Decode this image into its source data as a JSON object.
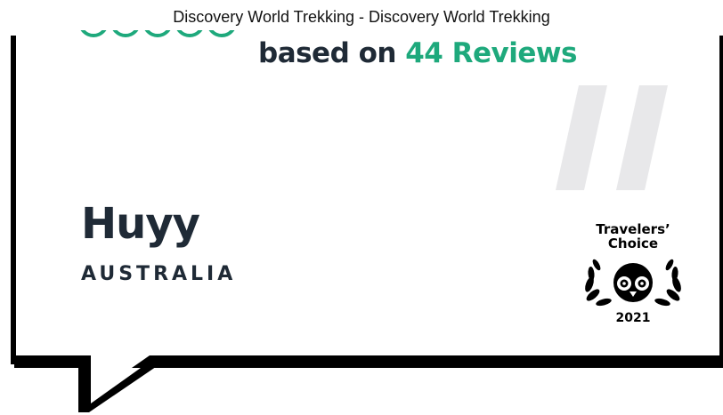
{
  "tooltip": {
    "text": "Discovery World Trekking - Discovery World Trekking"
  },
  "rating": {
    "prefix": "based on ",
    "count_text": "44 Reviews",
    "accent_color": "#1ea97c",
    "star_icon": "circle-rating-icon"
  },
  "review": {
    "name": "Huyy",
    "country": "AUSTRALIA"
  },
  "badge": {
    "title_line1": "Travelers’",
    "title_line2": "Choice",
    "year": "2021",
    "icon": "tripadvisor-owl-icon"
  }
}
